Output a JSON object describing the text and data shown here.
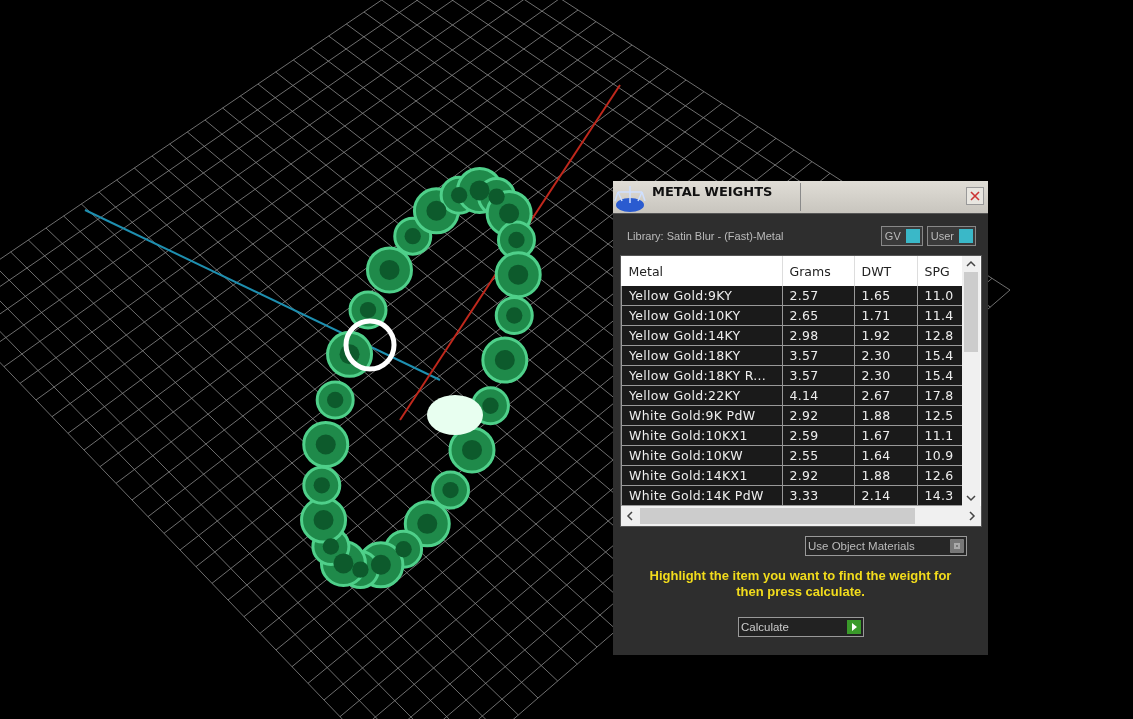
{
  "panel": {
    "title": "METAL WEIGHTS",
    "library": "Library: Satin Blur - (Fast)-Metal",
    "toggles": [
      {
        "label": "GV",
        "on": true
      },
      {
        "label": "User",
        "on": true
      }
    ],
    "table": {
      "columns": [
        "Metal",
        "Grams",
        "DWT",
        "SPG"
      ],
      "rows": [
        [
          "Yellow Gold:9KY",
          "2.57",
          "1.65",
          "11.0"
        ],
        [
          "Yellow Gold:10KY",
          "2.65",
          "1.71",
          "11.4"
        ],
        [
          "Yellow Gold:14KY",
          "2.98",
          "1.92",
          "12.8"
        ],
        [
          "Yellow Gold:18KY",
          "3.57",
          "2.30",
          "15.4"
        ],
        [
          "Yellow Gold:18KY R...",
          "3.57",
          "2.30",
          "15.4"
        ],
        [
          "Yellow Gold:22KY",
          "4.14",
          "2.67",
          "17.8"
        ],
        [
          "White Gold:9K PdW",
          "2.92",
          "1.88",
          "12.5"
        ],
        [
          "White Gold:10KX1",
          "2.59",
          "1.67",
          "11.1"
        ],
        [
          "White Gold:10KW",
          "2.55",
          "1.64",
          "10.9"
        ],
        [
          "White Gold:14KX1",
          "2.92",
          "1.88",
          "12.6"
        ],
        [
          "White Gold:14K PdW",
          "3.33",
          "2.14",
          "14.3"
        ]
      ]
    },
    "use_object_materials": {
      "label": "Use Object Materials",
      "on": false
    },
    "hint": "Highlight the item you want to find the weight for then press calculate.",
    "calculate_button": "Calculate"
  }
}
